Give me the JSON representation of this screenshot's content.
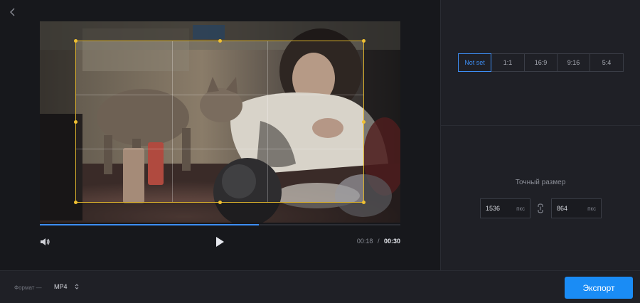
{
  "player": {
    "time_current": "00:18",
    "time_separator": "/",
    "time_total": "00:30",
    "progress": 0.607
  },
  "crop": {
    "ratios": [
      {
        "label": "Not set",
        "active": true
      },
      {
        "label": "1:1",
        "active": false
      },
      {
        "label": "16:9",
        "active": false
      },
      {
        "label": "9:16",
        "active": false
      },
      {
        "label": "5:4",
        "active": false
      }
    ],
    "size_title": "Точный размер",
    "width_value": "1536",
    "height_value": "864",
    "unit": "пкс"
  },
  "footer": {
    "format_label": "Формат —",
    "format_value": "MP4",
    "export_label": "Экспорт"
  },
  "colors": {
    "accent": "#3d8ef5",
    "export_bg": "#1a8cf5",
    "crop_border": "#d9b02c"
  },
  "icons": [
    "chevron-left-icon",
    "volume-icon",
    "play-icon",
    "link-icon",
    "sort-icon"
  ]
}
